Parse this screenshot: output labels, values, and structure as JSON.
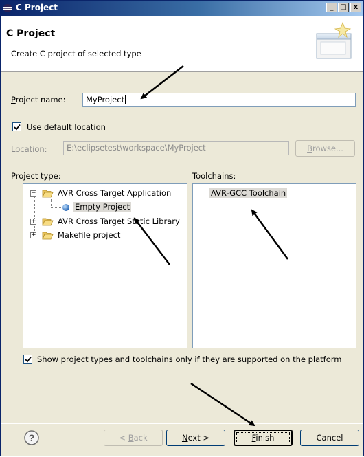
{
  "window": {
    "title": "C Project"
  },
  "header": {
    "title": "C Project",
    "description": "Create C project of selected type"
  },
  "form": {
    "project_name": {
      "label_u": "P",
      "label_rest": "roject name:",
      "value": "MyProject"
    },
    "use_default_location": {
      "label_pre": "Use ",
      "label_u": "d",
      "label_rest": "efault location",
      "checked": true
    },
    "location": {
      "label_u": "L",
      "label_rest": "ocation:",
      "value": "E:\\eclipsetest\\workspace\\MyProject"
    },
    "browse_button": {
      "label_u": "B",
      "label_rest": "rowse..."
    }
  },
  "project_type": {
    "label": "Project type:",
    "items": [
      {
        "label": "AVR Cross Target Application",
        "expanded": true,
        "children": [
          {
            "label": "Empty Project",
            "selected": true
          }
        ]
      },
      {
        "label": "AVR Cross Target Static Library",
        "expanded": false
      },
      {
        "label": "Makefile project",
        "expanded": false
      }
    ]
  },
  "toolchains": {
    "label": "Toolchains:",
    "items": [
      {
        "label": "AVR-GCC Toolchain",
        "selected": true
      }
    ]
  },
  "show_supported": {
    "label": "Show project types and toolchains only if they are supported on the platform",
    "checked": true
  },
  "buttons": {
    "help": "?",
    "back": {
      "pre": "< ",
      "u": "B",
      "rest": "ack"
    },
    "next": {
      "u": "N",
      "rest": "ext >"
    },
    "finish": {
      "u": "F",
      "rest": "inish"
    },
    "cancel": "Cancel"
  },
  "colors": {
    "titlebar": "#0a246a",
    "dialog_bg": "#ece9d8",
    "selection": "#dcdad5"
  }
}
